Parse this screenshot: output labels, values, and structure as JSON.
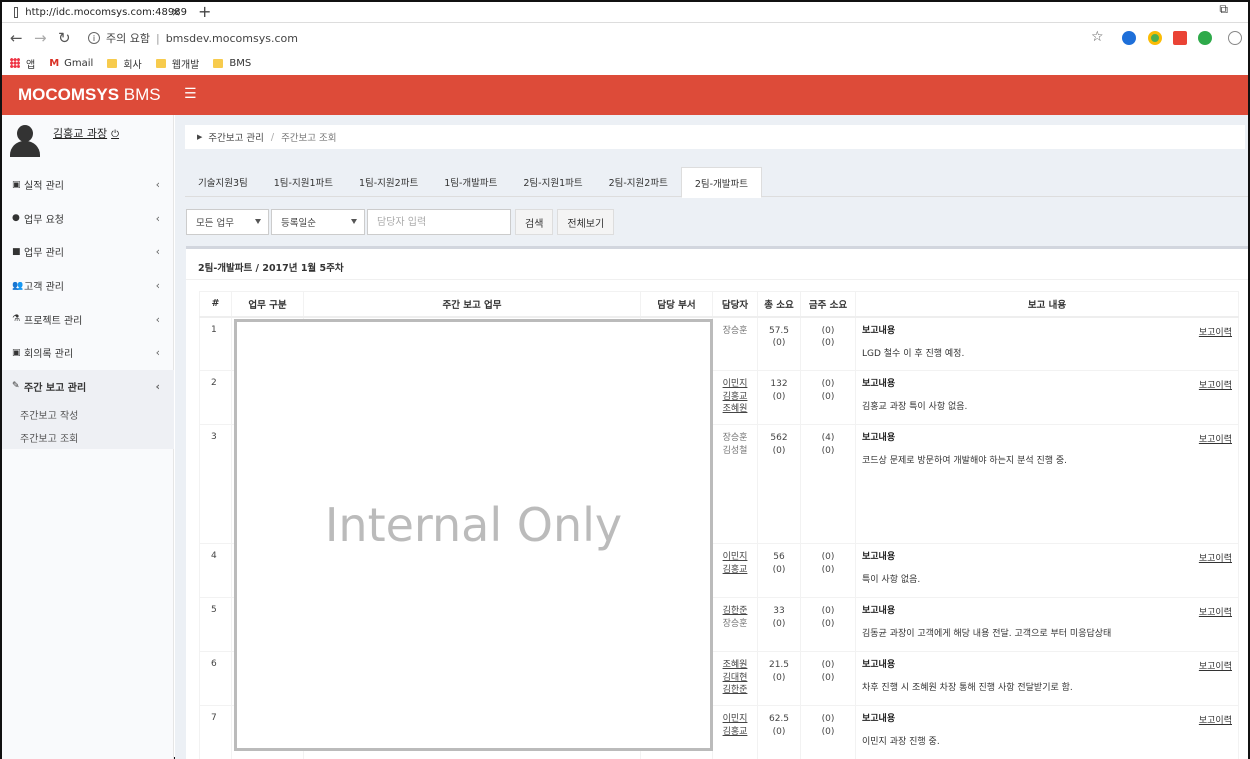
{
  "browser": {
    "tab_title": "http://idc.mocomsys.com:48989",
    "url_warning": "주의 요함",
    "url": "bmsdev.mocomsys.com",
    "bookmarks": [
      "앱",
      "Gmail",
      "회사",
      "웹개발",
      "BMS"
    ]
  },
  "header": {
    "logo_bold": "MOCOMSYS",
    "logo_light": "BMS",
    "menu_icon": "hamburger-icon"
  },
  "user": {
    "name": "김홍교 과장",
    "power_icon": "power-icon"
  },
  "sidebar": {
    "items": [
      {
        "label": "실적 관리",
        "icon": "calendar-icon"
      },
      {
        "label": "업무 요청",
        "icon": "circle-icon"
      },
      {
        "label": "업무 관리",
        "icon": "briefcase-icon"
      },
      {
        "label": "고객 관리",
        "icon": "users-icon"
      },
      {
        "label": "프로젝트 관리",
        "icon": "flask-icon"
      },
      {
        "label": "회의록 관리",
        "icon": "calendar-icon"
      },
      {
        "label": "주간 보고 관리",
        "icon": "pencil-icon"
      }
    ],
    "submenu": [
      "주간보고 작성",
      "주간보고 조회"
    ]
  },
  "breadcrumb": {
    "parent": "주간보고 관리",
    "current": "주간보고 조회"
  },
  "tabs": [
    "기술지원3팀",
    "1팀-지원1파트",
    "1팀-지원2파트",
    "1팀-개발파트",
    "2팀-지원1파트",
    "2팀-지원2파트",
    "2팀-개발파트"
  ],
  "active_tab": "2팀-개발파트",
  "filters": {
    "task_select": "모든 업무",
    "sort_select": "등록일순",
    "assignee_placeholder": "담당자 입력",
    "search_button": "검색",
    "view_all_button": "전체보기"
  },
  "report": {
    "title": "2팀-개발파트 / 2017년 1월 5주차",
    "columns": [
      "#",
      "업무 구분",
      "주간 보고 업무",
      "담당 부서",
      "담당자",
      "총 소요",
      "금주 소요",
      "보고 내용"
    ],
    "report_label": "보고내용",
    "history_label": "보고이력",
    "rows": [
      {
        "no": "1",
        "assignees": [
          {
            "name": "장승훈",
            "link": false
          }
        ],
        "total": "57.5",
        "total_sub": "(0)",
        "week": "(0)",
        "week_sub": "(0)",
        "content": "LGD 철수 이 후 진행 예정."
      },
      {
        "no": "2",
        "assignees": [
          {
            "name": "이민지",
            "link": true
          },
          {
            "name": "김홍교",
            "link": true
          },
          {
            "name": "조혜원",
            "link": true
          }
        ],
        "total": "132",
        "total_sub": "(0)",
        "week": "(0)",
        "week_sub": "(0)",
        "content": "김홍교 과장 특이 사항 없음."
      },
      {
        "no": "3",
        "assignees": [
          {
            "name": "장승훈",
            "link": false
          },
          {
            "name": "김성철",
            "link": false
          }
        ],
        "total": "562",
        "total_sub": "(0)",
        "week": "(4)",
        "week_sub": "(0)",
        "content": "코드상 문제로 방문하여 개발해야 하는지 분석 진행 중."
      },
      {
        "no": "4",
        "assignees": [
          {
            "name": "이민지",
            "link": true
          },
          {
            "name": "김홍교",
            "link": true
          }
        ],
        "total": "56",
        "total_sub": "(0)",
        "week": "(0)",
        "week_sub": "(0)",
        "content": "특이 사항 없음."
      },
      {
        "no": "5",
        "assignees": [
          {
            "name": "김한준",
            "link": true
          },
          {
            "name": "장승훈",
            "link": false
          }
        ],
        "total": "33",
        "total_sub": "(0)",
        "week": "(0)",
        "week_sub": "(0)",
        "content": "김동균 과장이 고객에게 해당 내용 전달. 고객으로 부터 미응답상태"
      },
      {
        "no": "6",
        "assignees": [
          {
            "name": "조혜원",
            "link": true
          },
          {
            "name": "김대현",
            "link": true
          },
          {
            "name": "김한준",
            "link": true
          }
        ],
        "total": "21.5",
        "total_sub": "(0)",
        "week": "(0)",
        "week_sub": "(0)",
        "content": "차후 진행 시 조혜원 차장 통해 진행 사항 전달받기로 함."
      },
      {
        "no": "7",
        "assignees": [
          {
            "name": "이민지",
            "link": true
          },
          {
            "name": "김홍교",
            "link": true
          }
        ],
        "total": "62.5",
        "total_sub": "(0)",
        "week": "(0)",
        "week_sub": "(0)",
        "content": "이민지 과장 진행 중."
      }
    ]
  },
  "overlay_text": "Internal Only"
}
